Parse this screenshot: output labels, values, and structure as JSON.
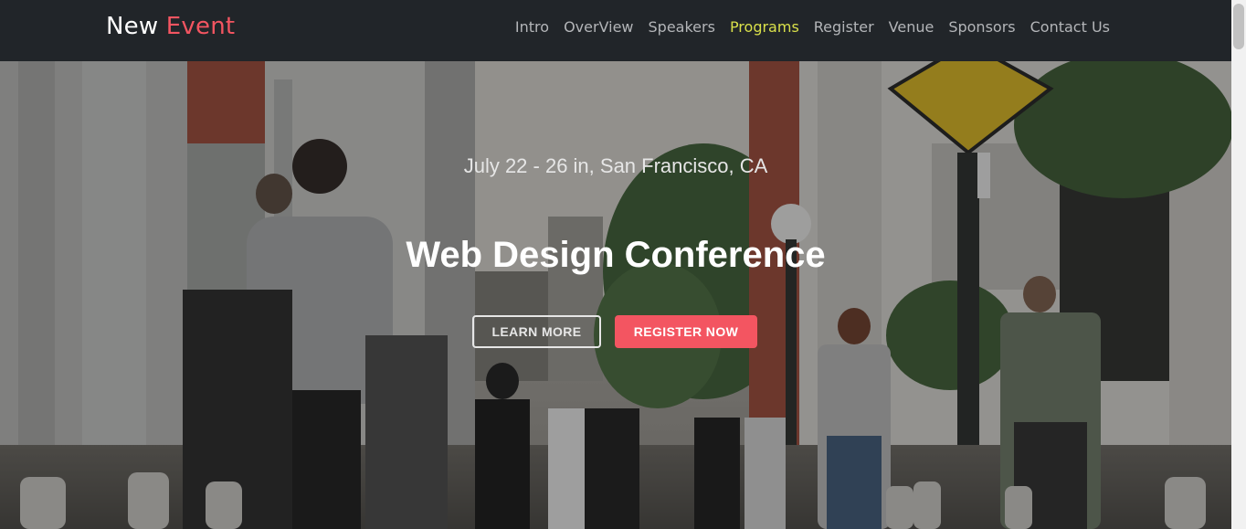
{
  "brand": {
    "first": "New",
    "second": "Event"
  },
  "nav": {
    "items": [
      "Intro",
      "OverView",
      "Speakers",
      "Programs",
      "Register",
      "Venue",
      "Sponsors",
      "Contact Us"
    ],
    "active": "Programs"
  },
  "hero": {
    "date": "July 22 - 26 in, San Francisco, CA",
    "title": "Web Design Conference",
    "learn_more": "LEARN MORE",
    "register_now": "REGISTER NOW",
    "background_icon": "street-crowd-photo"
  },
  "colors": {
    "accent": "#f35561",
    "nav_bg": "#212529",
    "nav_active": "#d9e04a"
  }
}
